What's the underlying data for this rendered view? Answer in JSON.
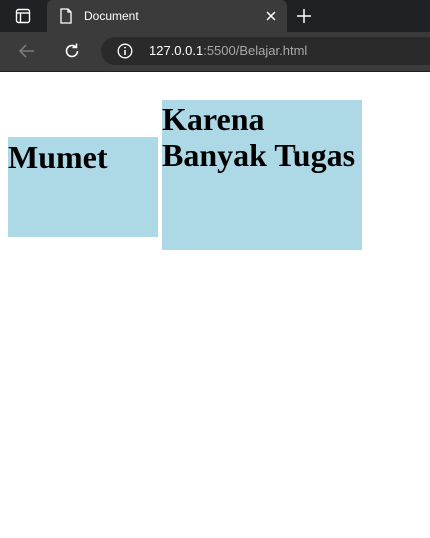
{
  "browser": {
    "tab": {
      "title": "Document"
    },
    "address": {
      "host": "127.0.0.1",
      "rest": ":5500/Belajar.html"
    }
  },
  "page": {
    "box_left": {
      "text": "Mumet",
      "color": "#add8e6"
    },
    "box_right": {
      "line1": "Karena",
      "line2": "Banyak Tugas",
      "color": "#add8e6"
    }
  },
  "icons": [
    "tab-actions-icon",
    "document-icon",
    "close-icon",
    "plus-icon",
    "back-arrow-icon",
    "reload-icon",
    "info-icon"
  ]
}
